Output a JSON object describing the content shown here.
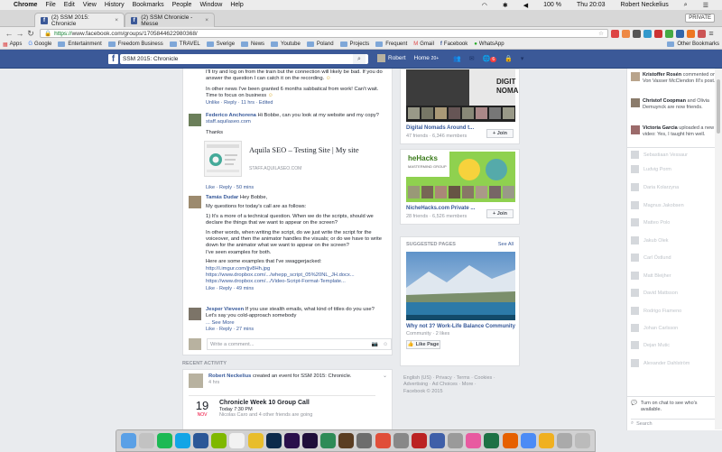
{
  "menubar": {
    "apple": "",
    "app": "Chrome",
    "items": [
      "File",
      "Edit",
      "View",
      "History",
      "Bookmarks",
      "People",
      "Window",
      "Help"
    ],
    "battery": "100 %",
    "clock": "Thu 20:03",
    "user": "Robert Neckelius"
  },
  "tabs": [
    {
      "label": "(2) SSM 2015: Chronicle",
      "close": "×"
    },
    {
      "label": "(2) SSM Chronicle - Messe",
      "close": "×"
    }
  ],
  "private_label": "PRIVATE",
  "url": {
    "scheme": "https://",
    "host": "www.facebook.com",
    "path": "/groups/1705844622980368/"
  },
  "bookmarks": [
    "Apps",
    "Google",
    "Entertainment",
    "Freedom Business",
    "TRAVEL",
    "Sverige",
    "News",
    "Youtube",
    "Poland",
    "Projects",
    "Frequent",
    "Gmail",
    "Facebook",
    "WhatsApp"
  ],
  "other_bookmarks": "Other Bookmarks",
  "fb": {
    "search_value": "SSM 2015: Chronicle",
    "user": "Robert",
    "home": "Home",
    "home_badge": "20+",
    "notif_badge": "6"
  },
  "post": {
    "c0_line1": "I'll try and log on from the train but the connection will likely be bad. If you do",
    "c0_line2": "answer the question I can catch it on the recording.",
    "c0_line3": "In other news I've been granted 6 months sabbatical from work! Can't wait.",
    "c0_line4": "Time to focus on business",
    "c0_meta": "Unlike · Reply · 11 hrs · Edited",
    "c1_name": "Federico Anchorena",
    "c1_text": "Hi Bobbe, can you look at my website and my copy?",
    "c1_link": "staff.aquilaseo.com",
    "c1_thanks": "Thanks",
    "share_title": "Aquila SEO – Testing Site | My site",
    "share_url": "STAFF.AQUILASEO.COM",
    "c1_meta": "Like · Reply · 50 mins",
    "c2_name": "Tamás Dudar",
    "c2_text": "Hey Bobbe,",
    "c2_p1": "My questions for today's call are as follows:",
    "c2_p2a": "1) It's a more of a technical question. When we do the scripts, should we",
    "c2_p2b": "declare the things that we want to appear on the screen?",
    "c2_p3a": "In other words, when writing the script, do we just write the script for the",
    "c2_p3b": "voiceover, and then the animator handles the visuals; or do we have to write",
    "c2_p3c": "down for the animator what we want to appear on the screen?",
    "c2_p3d": "I've seen examples for both.",
    "c2_p4": "Here are some examples that I've swaggerjacked:",
    "c2_l1": "http://i.imgur.com/jjv8Hh.jpg",
    "c2_l2": "https://www.dropbox.com/.../whepp_script_05%20NL_JH.docx...",
    "c2_l3": "https://www.dropbox.com/.../Video-Script-Format-Template...",
    "c2_meta": "Like · Reply · 49 mins",
    "c3_name": "Jesper Vieveen",
    "c3_text": "If you use stealth emails, what kind of titles do you use?",
    "c3_text2": "Let's say you cold-approach somebody",
    "c3_more": "... See More",
    "c3_meta": "Like · Reply · 27 mins",
    "comment_placeholder": "Write a comment..."
  },
  "recent": {
    "heading": "RECENT ACTIVITY",
    "actor": "Robert Neckelius",
    "action": "created an event for SSM 2015: Chronicle.",
    "time": "4 hrs",
    "day": "19",
    "month": "NOV",
    "event_title": "Chronicle Week 10 Group Call",
    "event_time": "Today 7:30 PM",
    "event_people": "Nicolas Caro and 4 other friends are going"
  },
  "groups": [
    {
      "title": "Digital Nomads Around t...",
      "sub": "47 friends · 6,346 members",
      "join": "+ Join",
      "img_text": "DIGIT NOMA"
    },
    {
      "title": "NicheHacks.com Private ...",
      "sub": "28 friends · 6,526 members",
      "join": "+ Join",
      "img_text": "heHacks",
      "img_sub": "MASTERMIND GROUP"
    }
  ],
  "suggested": {
    "heading": "SUGGESTED PAGES",
    "see_all": "See All",
    "title": "Why not 3? Work-Life Balance Community",
    "sub": "Community · 2 likes",
    "like": "Like Page"
  },
  "footer": {
    "line1": "English (US) · Privacy · Terms · Cookies ·",
    "line2": "Advertising · Ad Choices · More ·",
    "line3": "Facebook © 2015"
  },
  "ticker": [
    {
      "name": "Kristoffer Rosén",
      "text": "commented on Von Vasser McClendon III's post."
    },
    {
      "name": "Christof Coopman",
      "text": "and Olivia Demuynck are now friends."
    },
    {
      "name": "Victoria Garcia",
      "text": "uploaded a new video: Yes, I taught him well."
    }
  ],
  "contacts": [
    "Sebastiaan Vessaur",
    "Ludvig Porm",
    "Daria Kolarzyna",
    "Magnus Jakobsen",
    "Matteo Polo",
    "Jakub Olek",
    "Carl Östlund",
    "Matt Bleijher",
    "David Mattsson",
    "Rodrigo Fiameno",
    "Johan Carlsson",
    "Dejan Mutic",
    "Alexander Dahlström"
  ],
  "chat": {
    "prompt": "Turn on chat to see who's available.",
    "search": "Search"
  },
  "colors": {
    "fb_blue": "#3b5998",
    "link": "#365899",
    "bg": "#e9ebee"
  }
}
